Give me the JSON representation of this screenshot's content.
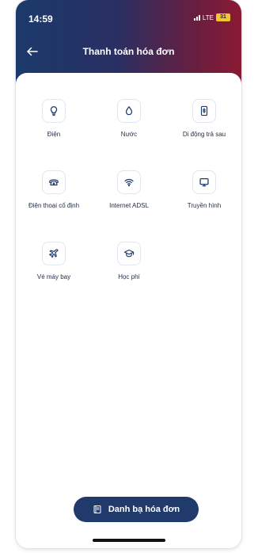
{
  "status_bar": {
    "time": "14:59",
    "network": "LTE",
    "battery": "31"
  },
  "header": {
    "title": "Thanh toán hóa đơn",
    "back_icon": "arrow-left-icon"
  },
  "services": [
    {
      "label": "Điện",
      "icon": "lightbulb-icon"
    },
    {
      "label": "Nước",
      "icon": "water-drop-icon"
    },
    {
      "label": "Di động trả sau",
      "icon": "mobile-dollar-icon"
    },
    {
      "label": "Điện thoại cố định",
      "icon": "telephone-icon"
    },
    {
      "label": "Internet ADSL",
      "icon": "wifi-icon"
    },
    {
      "label": "Truyền hình",
      "icon": "monitor-icon"
    },
    {
      "label": "Vé máy bay",
      "icon": "airplane-icon"
    },
    {
      "label": "Học phí",
      "icon": "graduation-cap-icon"
    }
  ],
  "footer": {
    "button_label": "Danh bạ hóa đơn",
    "button_icon": "address-book-icon"
  },
  "colors": {
    "header_gradient": [
      "#1b3a6b",
      "#8a1a33"
    ],
    "primary_button": "#1f3a6b",
    "icon_color": "#1f3a6b",
    "icon_border": "#e1e5ef"
  }
}
